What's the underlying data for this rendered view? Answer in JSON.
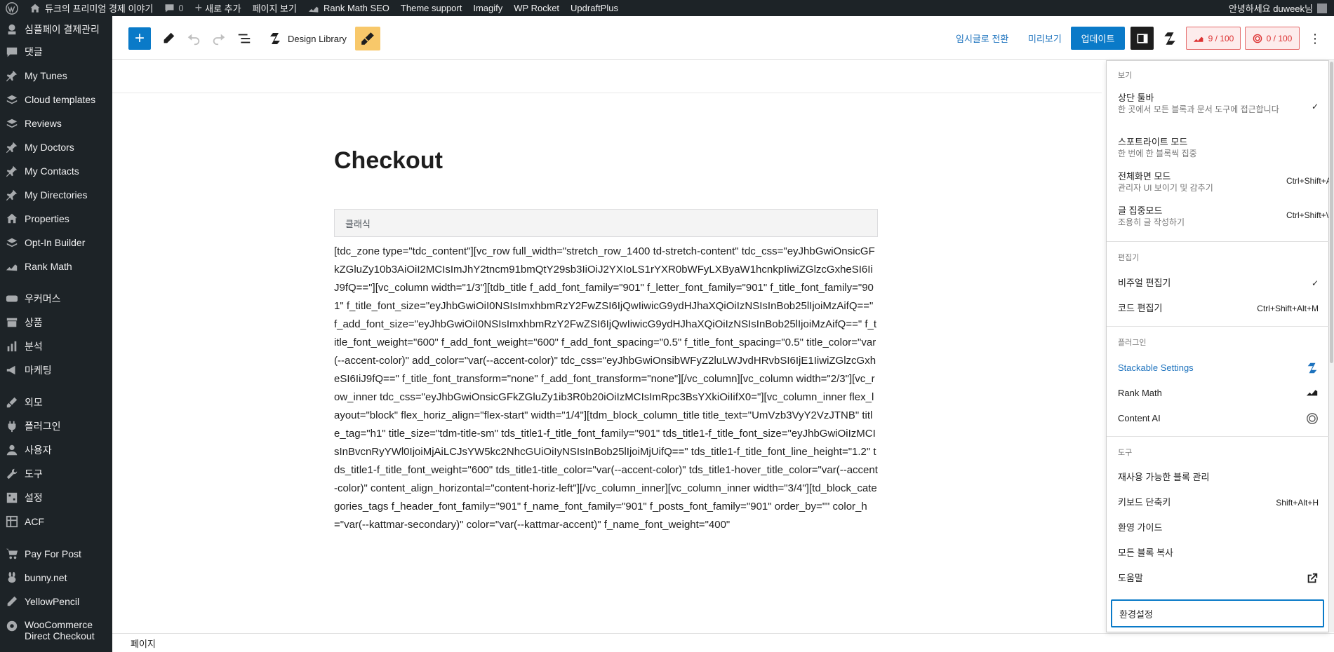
{
  "admin_bar": {
    "site_name": "듀크의 프리미엄 경제 이야기",
    "comments_count": "0",
    "new_label": "새로 추가",
    "view_page": "페이지 보기",
    "rank_math": "Rank Math SEO",
    "theme_support": "Theme support",
    "imagify": "Imagify",
    "wp_rocket": "WP Rocket",
    "updraftplus": "UpdraftPlus",
    "greeting": "안녕하세요 duweek님"
  },
  "sidebar": {
    "items": [
      {
        "label": "심플페이 결제관리",
        "icon": "payment-icon"
      },
      {
        "label": "댓글",
        "icon": "comment-icon"
      },
      {
        "label": "My Tunes",
        "icon": "pin-icon"
      },
      {
        "label": "Cloud templates",
        "icon": "layers-icon"
      },
      {
        "label": "Reviews",
        "icon": "layers-icon"
      },
      {
        "label": "My Doctors",
        "icon": "pin-icon"
      },
      {
        "label": "My Contacts",
        "icon": "pin-icon"
      },
      {
        "label": "My Directories",
        "icon": "pin-icon"
      },
      {
        "label": "Properties",
        "icon": "home-icon"
      },
      {
        "label": "Opt-In Builder",
        "icon": "layers-icon"
      },
      {
        "label": "Rank Math",
        "icon": "chart-icon"
      },
      {
        "label": "우커머스",
        "icon": "woo-icon"
      },
      {
        "label": "상품",
        "icon": "archive-icon"
      },
      {
        "label": "분석",
        "icon": "bar-chart-icon"
      },
      {
        "label": "마케팅",
        "icon": "megaphone-icon"
      },
      {
        "label": "외모",
        "icon": "brush-icon"
      },
      {
        "label": "플러그인",
        "icon": "plugin-icon"
      },
      {
        "label": "사용자",
        "icon": "user-icon"
      },
      {
        "label": "도구",
        "icon": "wrench-icon"
      },
      {
        "label": "설정",
        "icon": "settings-icon"
      },
      {
        "label": "ACF",
        "icon": "grid-icon"
      },
      {
        "label": "Pay For Post",
        "icon": "cart-icon"
      },
      {
        "label": "bunny.net",
        "icon": "bunny-icon"
      },
      {
        "label": "YellowPencil",
        "icon": "pencil-icon"
      },
      {
        "label": "WooCommerce Direct Checkout",
        "icon": "gear-icon"
      }
    ]
  },
  "header": {
    "design_library": "Design Library",
    "save_draft": "임시글로 전환",
    "preview": "미리보기",
    "update": "업데이트",
    "seo_score": "9 / 100",
    "readability_score": "0 / 100"
  },
  "content": {
    "title": "Checkout",
    "classic_label": "클래식",
    "shortcode": "[tdc_zone type=\"tdc_content\"][vc_row full_width=\"stretch_row_1400 td-stretch-content\" tdc_css=\"eyJhbGwiOnsicGFkZGluZy10b3AiOiI2MCIsImJhY2tncm91bmQtY29sb3IiOiJ2YXIoLS1rYXR0bWFyLXByaW1hcnkpIiwiZGlzcGxheSI6IiJ9fQ==\"][vc_column width=\"1/3\"][tdb_title f_add_font_family=\"901\" f_letter_font_family=\"901\" f_title_font_family=\"901\" f_title_font_size=\"eyJhbGwiOiI0NSIsImxhbmRzY2FwZSI6IjQwIiwicG9ydHJhaXQiOiIzNSIsInBob25lIjoiMzAifQ==\" f_add_font_size=\"eyJhbGwiOiI0NSIsImxhbmRzY2FwZSI6IjQwIiwicG9ydHJhaXQiOiIzNSIsInBob25lIjoiMzAifQ==\" f_title_font_weight=\"600\" f_add_font_weight=\"600\" f_add_font_spacing=\"0.5\" f_title_font_spacing=\"0.5\" title_color=\"var(--accent-color)\" add_color=\"var(--accent-color)\" tdc_css=\"eyJhbGwiOnsibWFyZ2luLWJvdHRvbSI6IjE1IiwiZGlzcGxheSI6IiJ9fQ==\" f_title_font_transform=\"none\" f_add_font_transform=\"none\"][/vc_column][vc_column width=\"2/3\"][vc_row_inner tdc_css=\"eyJhbGwiOnsicGFkZGluZy1ib3R0b20iOiIzMCIsImRpc3BsYXkiOiIifX0=\"][vc_column_inner flex_layout=\"block\" flex_horiz_align=\"flex-start\" width=\"1/4\"][tdm_block_column_title title_text=\"UmVzb3VyY2VzJTNB\" title_tag=\"h1\" title_size=\"tdm-title-sm\" tds_title1-f_title_font_family=\"901\" tds_title1-f_title_font_size=\"eyJhbGwiOiIzMCIsInBvcnRyYWl0IjoiMjAiLCJsYW5kc2NhcGUiOiIyNSIsInBob25lIjoiMjUifQ==\" tds_title1-f_title_font_line_height=\"1.2\" tds_title1-f_title_font_weight=\"600\" tds_title1-title_color=\"var(--accent-color)\" tds_title1-hover_title_color=\"var(--accent-color)\" content_align_horizontal=\"content-horiz-left\"][/vc_column_inner][vc_column_inner width=\"3/4\"][td_block_categories_tags f_header_font_family=\"901\" f_name_font_family=\"901\" f_posts_font_family=\"901\" order_by=\"\" color_h=\"var(--kattmar-secondary)\" color=\"var(--kattmar-accent)\" f_name_font_weight=\"400\""
  },
  "footer": {
    "breadcrumb": "페이지"
  },
  "options_menu": {
    "view_group": "보기",
    "top_toolbar": {
      "title": "상단 툴바",
      "desc": "한 곳에서 모든 블록과 문서 도구에 접근합니다",
      "check": "✓"
    },
    "spotlight": {
      "title": "스포트라이트 모드",
      "desc": "한 번에 한 블록씩 집중"
    },
    "fullscreen": {
      "title": "전체화면 모드",
      "desc": "관리자 UI 보이기 및 감추기",
      "shortcut": "Ctrl+Shift+Alt+F"
    },
    "distraction_free": {
      "title": "글 집중모드",
      "desc": "조용히 글 작성하기",
      "shortcut": "Ctrl+Shift+\\"
    },
    "editor_group": "편집기",
    "visual_editor": {
      "title": "비주얼 편집기",
      "check": "✓"
    },
    "code_editor": {
      "title": "코드 편집기",
      "shortcut": "Ctrl+Shift+Alt+M"
    },
    "plugins_group": "플러그인",
    "stackable": {
      "title": "Stackable Settings"
    },
    "rank_math": {
      "title": "Rank Math"
    },
    "content_ai": {
      "title": "Content AI"
    },
    "tools_group": "도구",
    "reusable_blocks": {
      "title": "재사용 가능한 블록 관리"
    },
    "keyboard_shortcuts": {
      "title": "키보드 단축키",
      "shortcut": "Shift+Alt+H"
    },
    "welcome_guide": {
      "title": "환영 가이드"
    },
    "copy_all": {
      "title": "모든 블록 복사"
    },
    "help": {
      "title": "도움말"
    },
    "preferences": "환경설정"
  },
  "colors": {
    "admin_bg": "#1d2327",
    "accent": "#0a7ac8",
    "score_red": "#d33",
    "yellowpencil": "#f8c86a"
  }
}
